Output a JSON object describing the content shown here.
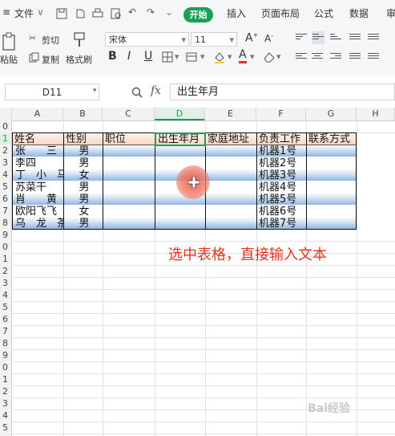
{
  "menu": {
    "file": "文件",
    "tabs": [
      "开始",
      "插入",
      "页面布局",
      "公式",
      "数据",
      "审"
    ]
  },
  "ribbon": {
    "paste": "粘贴",
    "cut": "剪切",
    "copy": "复制",
    "format_painter": "格式刷",
    "font_name": "宋体",
    "font_size": "11",
    "bold": "B",
    "italic": "I",
    "underline": "U",
    "font_color_letter": "A",
    "grow": "A+",
    "shrink": "A-"
  },
  "formula_bar": {
    "name_box": "D11",
    "fx": "fx",
    "content": "出生年月"
  },
  "columns": [
    "A",
    "B",
    "C",
    "D",
    "E",
    "F",
    "G",
    "H"
  ],
  "selected_column": "D",
  "rows": [
    "0",
    "1",
    "2",
    "3",
    "4",
    "5",
    "6",
    "7",
    "8",
    "9",
    "0",
    "1",
    "2",
    "3",
    "4",
    "5",
    "6",
    "7",
    "8",
    "9",
    "0",
    "1",
    "2",
    "3",
    "4",
    "5"
  ],
  "headers": [
    "姓名",
    "性别",
    "职位",
    "出生年月",
    "家庭地址",
    "负责工作",
    "联系方式"
  ],
  "records": [
    {
      "name": "张　　三",
      "gender": "男",
      "work": "机器1号"
    },
    {
      "name": "李四",
      "gender": "男",
      "work": "机器2号"
    },
    {
      "name": "丁　小　马",
      "gender": "女",
      "work": "机器3号"
    },
    {
      "name": "苏菜干",
      "gender": "男",
      "work": "机器4号"
    },
    {
      "name": "肖　　黄",
      "gender": "男",
      "work": "机器5号"
    },
    {
      "name": "欧阳飞飞",
      "gender": "女",
      "work": "机器6号"
    },
    {
      "name": "乌　龙　茶",
      "gender": "男",
      "work": "机器7号"
    }
  ],
  "annotation": "选中表格，直接输入文本",
  "watermark": "Bai经验",
  "colors": {
    "accent_green": "#18a058",
    "annotation_red": "#e8301c",
    "band_blue": "#8fb6e0"
  }
}
